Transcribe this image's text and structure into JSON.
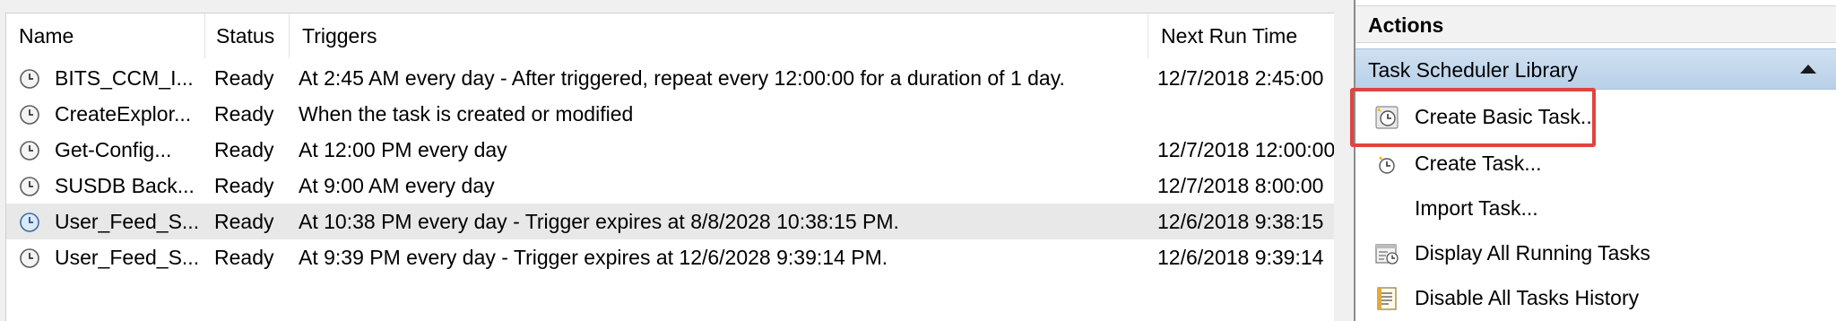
{
  "columns": {
    "name": "Name",
    "status": "Status",
    "triggers": "Triggers",
    "next_run": "Next Run Time"
  },
  "tasks": [
    {
      "name": "BITS_CCM_I...",
      "status": "Ready",
      "triggers": "At 2:45 AM every day - After triggered, repeat every 12:00:00 for a duration of 1 day.",
      "next_run": "12/7/2018 2:45:00"
    },
    {
      "name": "CreateExplor...",
      "status": "Ready",
      "triggers": "When the task is created or modified",
      "next_run": ""
    },
    {
      "name": "Get-Config...",
      "status": "Ready",
      "triggers": "At 12:00 PM every day",
      "next_run": "12/7/2018 12:00:00"
    },
    {
      "name": "SUSDB Back...",
      "status": "Ready",
      "triggers": "At 9:00 AM every day",
      "next_run": "12/7/2018 8:00:00"
    },
    {
      "name": "User_Feed_S...",
      "status": "Ready",
      "triggers": "At 10:38 PM every day - Trigger expires at 8/8/2028 10:38:15 PM.",
      "next_run": "12/6/2018 9:38:15"
    },
    {
      "name": "User_Feed_S...",
      "status": "Ready",
      "triggers": "At 9:39 PM every day - Trigger expires at 12/6/2028 9:39:14 PM.",
      "next_run": "12/6/2018 9:39:14"
    }
  ],
  "actions": {
    "header": "Actions",
    "section_title": "Task Scheduler Library",
    "items": [
      {
        "label": "Create Basic Task...",
        "icon": "create-basic-task-icon"
      },
      {
        "label": "Create Task...",
        "icon": "create-task-icon"
      },
      {
        "label": "Import Task...",
        "icon": ""
      },
      {
        "label": "Display All Running Tasks",
        "icon": "running-tasks-icon"
      },
      {
        "label": "Disable All Tasks History",
        "icon": "history-icon"
      }
    ]
  },
  "colors": {
    "highlight": "#e0443e",
    "section_bar": "#c4d8ec",
    "selected_row": "#e8e8e8"
  }
}
